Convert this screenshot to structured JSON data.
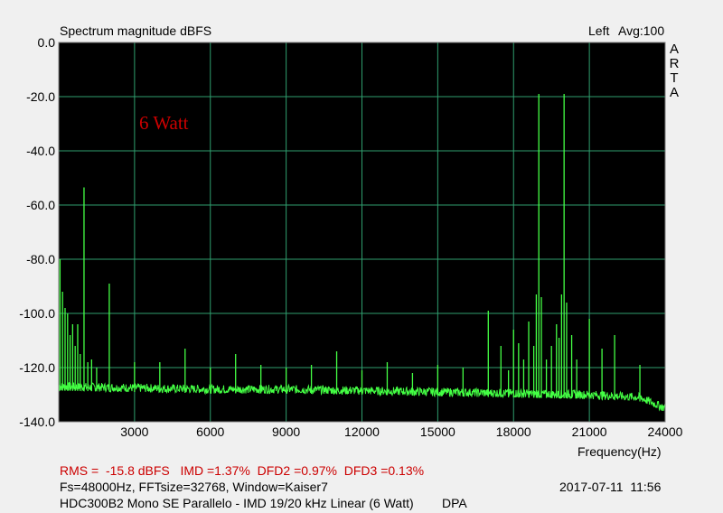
{
  "header": {
    "title": "Spectrum magnitude dBFS",
    "channel": "Left",
    "avg": "Avg:100",
    "brand_letters": [
      "A",
      "R",
      "T",
      "A"
    ]
  },
  "annotation": {
    "text": "6 Watt",
    "color": "#cc0000"
  },
  "footer": {
    "stats": "RMS =  -15.8 dBFS   IMD =1.37%  DFD2 =0.97%  DFD3 =0.13%",
    "params": "Fs=48000Hz, FFTsize=32768, Window=Kaiser7",
    "datetime": "2017-07-11  11:56",
    "description": "HDC300B2 Mono SE Parallelo - IMD 19/20 kHz Linear (6 Watt)",
    "tag": "DPA"
  },
  "colors": {
    "plot_background": "#000000",
    "grid": "#2f9e6e",
    "trace": "#44ff44",
    "annotation": "#cc0000",
    "stats_text": "#cc0000"
  },
  "chart_data": {
    "type": "line",
    "title": "Spectrum magnitude dBFS",
    "xlabel": "Frequency(Hz)",
    "ylabel": "",
    "xlim": [
      0,
      24000
    ],
    "ylim": [
      -140,
      0
    ],
    "x_tick_labels": [
      "3000",
      "6000",
      "9000",
      "12000",
      "15000",
      "18000",
      "21000",
      "24000"
    ],
    "y_tick_labels": [
      "0.0",
      "-20.0",
      "-40.0",
      "-60.0",
      "-80.0",
      "-100.0",
      "-120.0",
      "-140.0"
    ],
    "grid": true,
    "noise_floor": [
      {
        "x": 0,
        "y": -127
      },
      {
        "x": 3000,
        "y": -127.5
      },
      {
        "x": 6000,
        "y": -128
      },
      {
        "x": 9000,
        "y": -128
      },
      {
        "x": 12000,
        "y": -128.5
      },
      {
        "x": 15000,
        "y": -129
      },
      {
        "x": 18000,
        "y": -129.5
      },
      {
        "x": 21000,
        "y": -130
      },
      {
        "x": 23000,
        "y": -131
      },
      {
        "x": 24000,
        "y": -135
      }
    ],
    "peaks": [
      {
        "x": 50,
        "y": -80
      },
      {
        "x": 150,
        "y": -92
      },
      {
        "x": 250,
        "y": -98
      },
      {
        "x": 350,
        "y": -100
      },
      {
        "x": 450,
        "y": -108
      },
      {
        "x": 550,
        "y": -104
      },
      {
        "x": 650,
        "y": -112
      },
      {
        "x": 750,
        "y": -104
      },
      {
        "x": 850,
        "y": -115
      },
      {
        "x": 1000,
        "y": -53.5
      },
      {
        "x": 1150,
        "y": -118
      },
      {
        "x": 1300,
        "y": -117
      },
      {
        "x": 1500,
        "y": -120
      },
      {
        "x": 2000,
        "y": -89
      },
      {
        "x": 3000,
        "y": -118
      },
      {
        "x": 4000,
        "y": -118
      },
      {
        "x": 5000,
        "y": -113
      },
      {
        "x": 6000,
        "y": -120
      },
      {
        "x": 7000,
        "y": -115
      },
      {
        "x": 8000,
        "y": -119
      },
      {
        "x": 9000,
        "y": -120
      },
      {
        "x": 10000,
        "y": -119
      },
      {
        "x": 11000,
        "y": -114
      },
      {
        "x": 12000,
        "y": -121
      },
      {
        "x": 13000,
        "y": -118
      },
      {
        "x": 14000,
        "y": -122
      },
      {
        "x": 15000,
        "y": -119
      },
      {
        "x": 16000,
        "y": -120
      },
      {
        "x": 17000,
        "y": -99
      },
      {
        "x": 17500,
        "y": -112
      },
      {
        "x": 17800,
        "y": -121
      },
      {
        "x": 18000,
        "y": -106
      },
      {
        "x": 18200,
        "y": -111
      },
      {
        "x": 18400,
        "y": -117
      },
      {
        "x": 18600,
        "y": -103
      },
      {
        "x": 18800,
        "y": -112
      },
      {
        "x": 18900,
        "y": -93
      },
      {
        "x": 19000,
        "y": -19
      },
      {
        "x": 19100,
        "y": -94
      },
      {
        "x": 19300,
        "y": -117
      },
      {
        "x": 19500,
        "y": -112
      },
      {
        "x": 19700,
        "y": -104
      },
      {
        "x": 19800,
        "y": -109
      },
      {
        "x": 19900,
        "y": -93
      },
      {
        "x": 20000,
        "y": -19
      },
      {
        "x": 20100,
        "y": -96
      },
      {
        "x": 20300,
        "y": -108
      },
      {
        "x": 20500,
        "y": -117
      },
      {
        "x": 21000,
        "y": -102
      },
      {
        "x": 21500,
        "y": -113
      },
      {
        "x": 22000,
        "y": -108
      },
      {
        "x": 23000,
        "y": -119
      }
    ]
  }
}
